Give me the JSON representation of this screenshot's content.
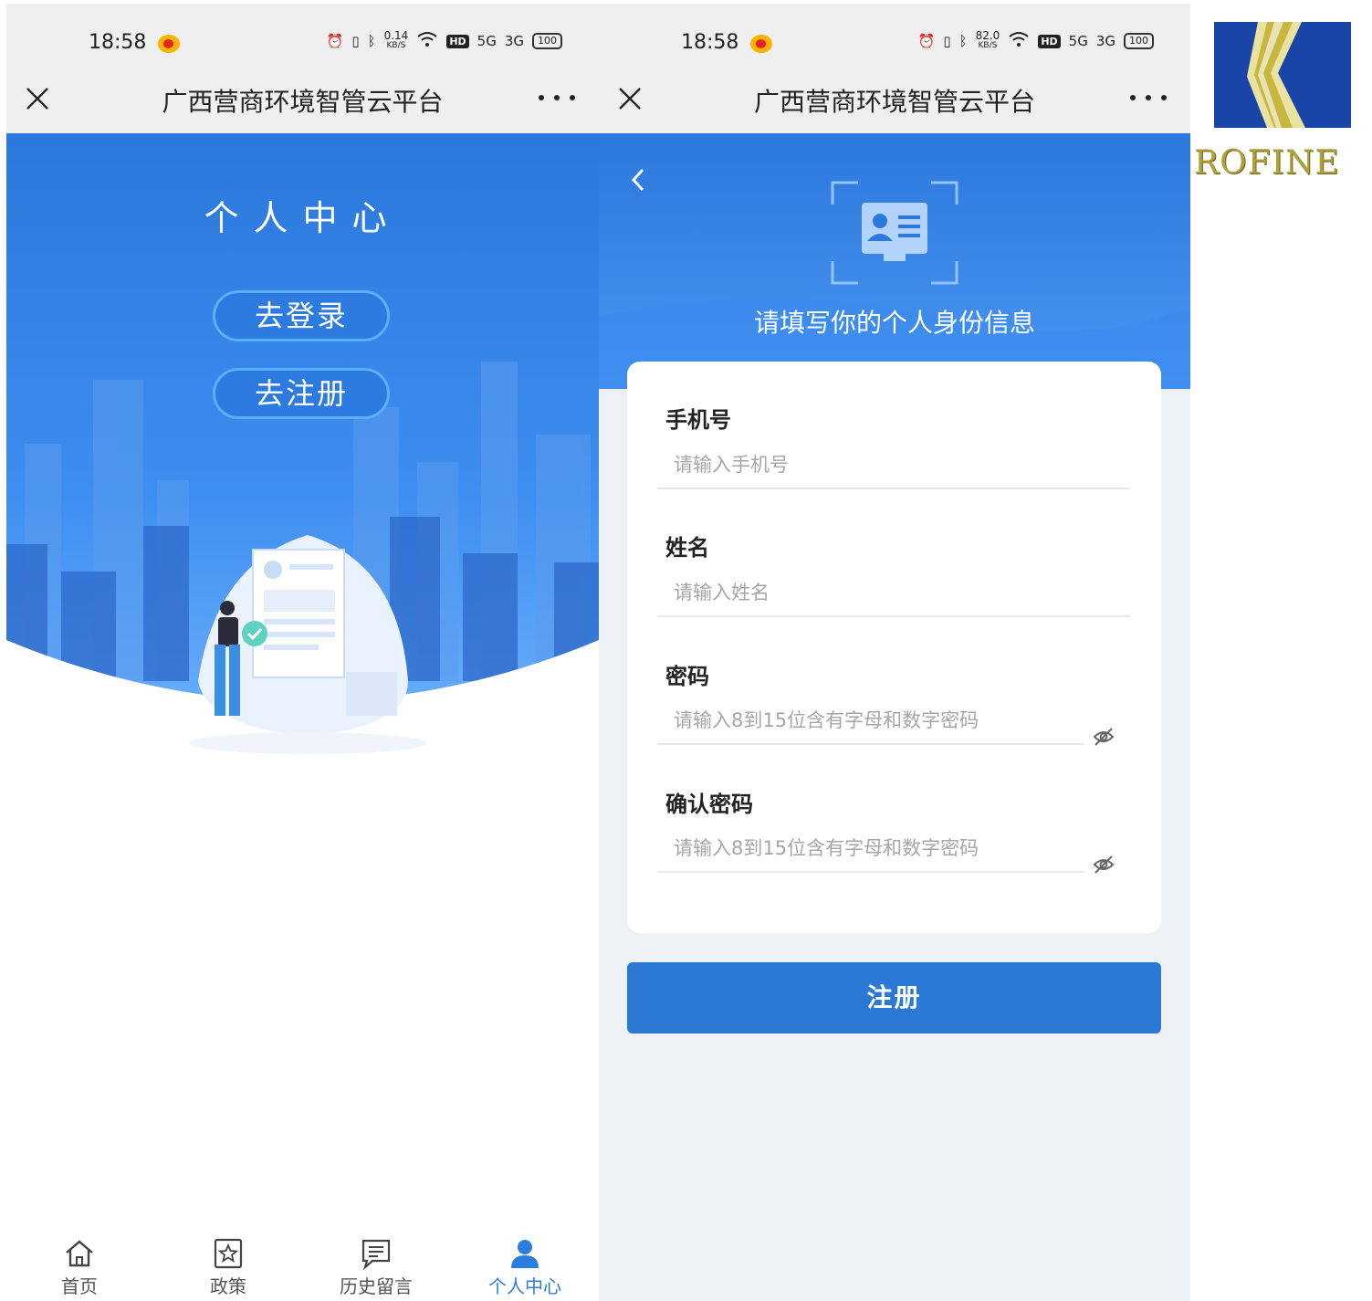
{
  "status_bar": {
    "time": "18:58",
    "left_speed": "0.14",
    "right_speed": "82.0",
    "speed_unit": "KB/S",
    "hd": "HD",
    "net_5g": "5G",
    "net_3g": "3G",
    "battery": "100"
  },
  "window_title": "广西营商环境智管云平台",
  "left_screen": {
    "heading": "个人中心",
    "login_label": "去登录",
    "register_label": "去注册",
    "tabs": [
      {
        "label": "首页",
        "icon": "home-icon"
      },
      {
        "label": "政策",
        "icon": "policy-star-icon"
      },
      {
        "label": "历史留言",
        "icon": "message-list-icon"
      },
      {
        "label": "个人中心",
        "icon": "user-icon",
        "active": true
      }
    ]
  },
  "right_screen": {
    "prompt": "请填写你的个人身份信息",
    "fields": [
      {
        "label": "手机号",
        "placeholder": "请输入手机号"
      },
      {
        "label": "姓名",
        "placeholder": "请输入姓名"
      },
      {
        "label": "密码",
        "placeholder": "请输入8到15位含有字母和数字密码"
      },
      {
        "label": "确认密码",
        "placeholder": "请输入8到15位含有字母和数字密码"
      }
    ],
    "submit_label": "注册"
  },
  "logo": {
    "text": "ROFINE"
  },
  "colors": {
    "primary": "#2b79d4",
    "accent_light": "#5ab0ff",
    "active_tab": "#2b7de0",
    "logo_gold": "#b0a23a"
  }
}
